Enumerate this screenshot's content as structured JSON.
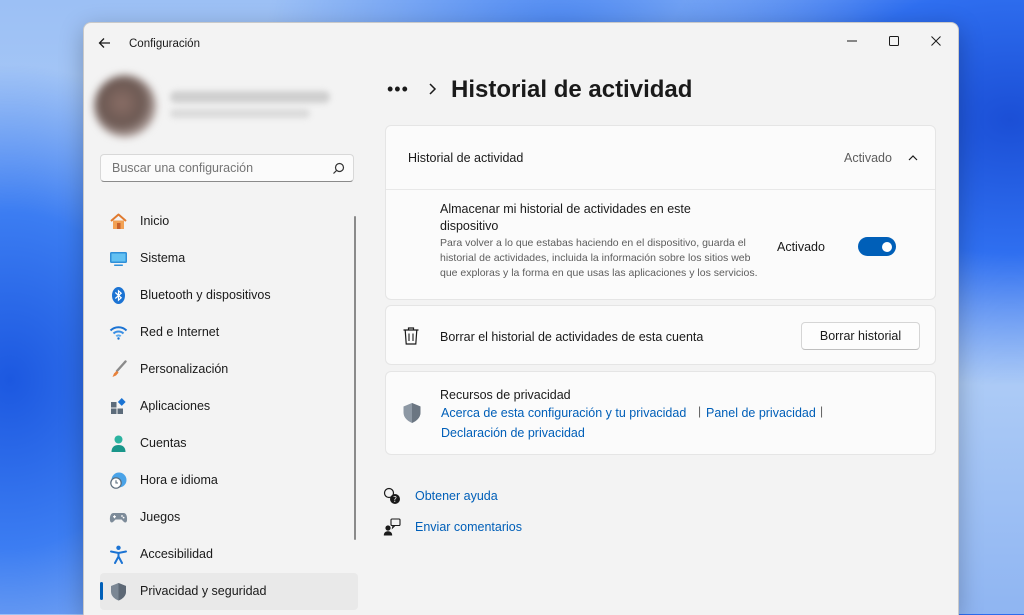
{
  "window": {
    "title": "Configuración"
  },
  "search": {
    "placeholder": "Buscar una configuración"
  },
  "sidebar": {
    "items": [
      {
        "label": "Inicio",
        "icon": "home-icon"
      },
      {
        "label": "Sistema",
        "icon": "monitor-icon"
      },
      {
        "label": "Bluetooth y dispositivos",
        "icon": "bluetooth-icon"
      },
      {
        "label": "Red e Internet",
        "icon": "wifi-icon"
      },
      {
        "label": "Personalización",
        "icon": "brush-icon"
      },
      {
        "label": "Aplicaciones",
        "icon": "apps-icon"
      },
      {
        "label": "Cuentas",
        "icon": "person-icon"
      },
      {
        "label": "Hora e idioma",
        "icon": "clock-globe-icon"
      },
      {
        "label": "Juegos",
        "icon": "gamepad-icon"
      },
      {
        "label": "Accesibilidad",
        "icon": "accessibility-icon"
      },
      {
        "label": "Privacidad y seguridad",
        "icon": "shield-icon",
        "active": true
      }
    ]
  },
  "main": {
    "breadcrumb_dots": "•••",
    "page_title": "Historial de actividad",
    "history_card": {
      "title": "Historial de actividad",
      "status": "Activado",
      "setting_title": "Almacenar mi historial de actividades en este dispositivo",
      "setting_description": "Para volver a lo que estabas haciendo en el dispositivo, guarda el historial de actividades, incluida la información sobre los sitios web que exploras y la forma en que usas las aplicaciones y los servicios.",
      "toggle_label": "Activado",
      "toggle_on": true
    },
    "clear_card": {
      "text": "Borrar el historial de actividades de esta cuenta",
      "button_label": "Borrar historial"
    },
    "privacy_card": {
      "title": "Recursos de privacidad",
      "links": [
        "Acerca de esta configuración y tu privacidad",
        "Panel de privacidad",
        "Declaración de privacidad"
      ],
      "separator": "|"
    },
    "help": {
      "get_help": "Obtener ayuda",
      "feedback": "Enviar comentarios"
    }
  },
  "colors": {
    "accent": "#005fb8",
    "window_bg": "#f3f3f3",
    "card_bg": "#fbfbfb"
  }
}
